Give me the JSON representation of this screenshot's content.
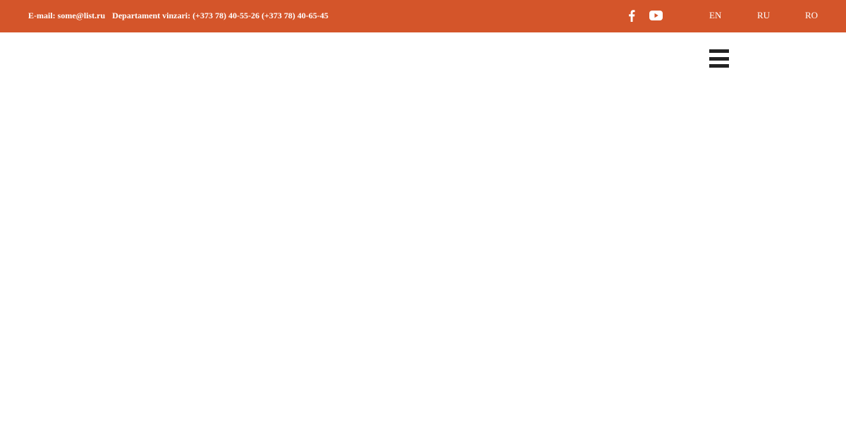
{
  "colors": {
    "topbar_background": "#d4552a",
    "topbar_text": "#ffffff",
    "page_background": "#ffffff",
    "menu_icon": "#222222"
  },
  "topbar": {
    "email_text": "E-mail: some@list.ru",
    "sales_text": "Departament vinzari: (+373 78) 40-55-26 (+373 78) 40-65-45",
    "social": [
      {
        "icon": "facebook-icon"
      },
      {
        "icon": "youtube-icon"
      }
    ],
    "languages": [
      "EN",
      "RU",
      "RO"
    ]
  },
  "header": {
    "menu_icon": "hamburger-menu-icon"
  }
}
